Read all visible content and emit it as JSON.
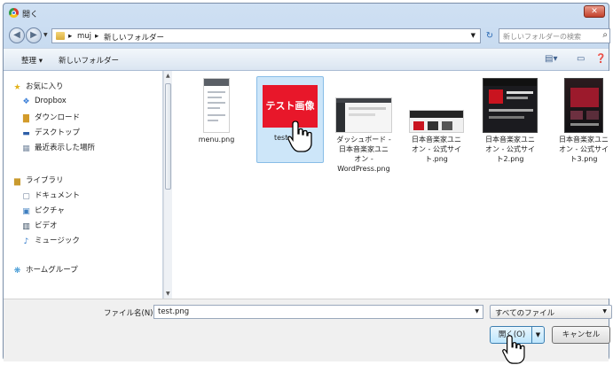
{
  "window": {
    "title": "開く",
    "close_label": "✕"
  },
  "address": {
    "crumbs": [
      "muj",
      "新しいフォルダー"
    ],
    "search_placeholder": "新しいフォルダーの検索"
  },
  "toolbar": {
    "organize": "整理 ▾",
    "new_folder": "新しいフォルダー"
  },
  "sidebar": {
    "favorites": "お気に入り",
    "fav_items": [
      "Dropbox",
      "ダウンロード",
      "デスクトップ",
      "最近表示した場所"
    ],
    "libraries": "ライブラリ",
    "lib_items": [
      "ドキュメント",
      "ピクチャ",
      "ビデオ",
      "ミュージック"
    ],
    "homegroup": "ホームグループ"
  },
  "files": [
    {
      "name": "menu.png"
    },
    {
      "name": "test.png",
      "label_visible": "test",
      "thumb_text": "テスト画像"
    },
    {
      "name": "ダッシュボード - 日本音楽家ユニオン - WordPress.png",
      "lines": [
        "ダッシュボード -",
        "日本音楽家ユニ",
        "オン -",
        "WordPress.png"
      ]
    },
    {
      "name": "日本音楽家ユニオン - 公式サイト.png",
      "lines": [
        "日本音楽家ユニ",
        "オン - 公式サイ",
        "ト.png"
      ]
    },
    {
      "name": "日本音楽家ユニオン - 公式サイト2.png",
      "lines": [
        "日本音楽家ユニ",
        "オン - 公式サイ",
        "ト2.png"
      ]
    },
    {
      "name": "日本音楽家ユニオン - 公式サイト3.png",
      "lines": [
        "日本音楽家ユニ",
        "オン - 公式サイ",
        "ト3.png"
      ]
    }
  ],
  "bottom": {
    "filename_label": "ファイル名(N):",
    "filename_value": "test.png",
    "filetype": "すべてのファイル",
    "open_label": "開く(O)",
    "cancel_label": "キャンセル"
  }
}
